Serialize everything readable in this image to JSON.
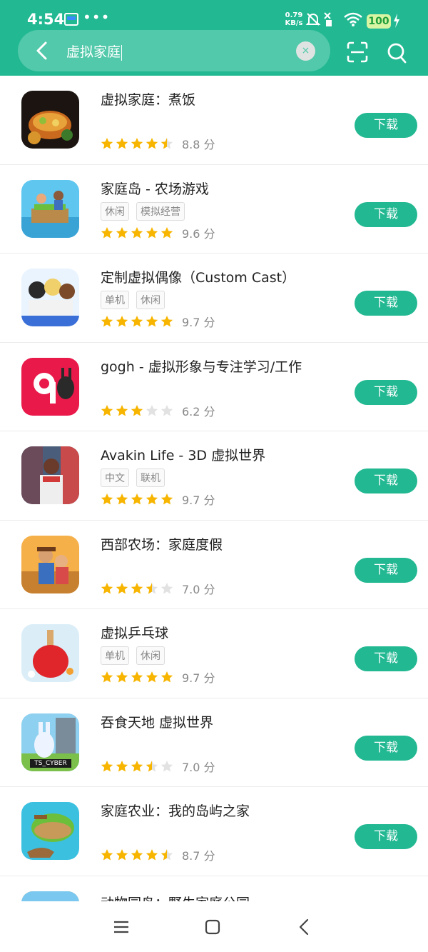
{
  "status_bar": {
    "time": "4:54",
    "net_speed_value": "0.79",
    "net_speed_unit": "KB/s",
    "battery": "100"
  },
  "search": {
    "query": "虚拟家庭",
    "clear_symbol": "×"
  },
  "colors": {
    "accent": "#22b892",
    "star_filled": "#f7b500",
    "star_empty": "#e2e2e2"
  },
  "apps": [
    {
      "name": "虚拟家庭：煮饭",
      "tags": [],
      "rating": 4.5,
      "score": "8.8 分",
      "button": "下载"
    },
    {
      "name": "家庭岛 - 农场游戏",
      "tags": [
        "休闲",
        "模拟经营"
      ],
      "rating": 5,
      "score": "9.6 分",
      "button": "下载"
    },
    {
      "name": "定制虚拟偶像（Custom Cast）",
      "tags": [
        "单机",
        "休闲"
      ],
      "rating": 5,
      "score": "9.7 分",
      "button": "下载"
    },
    {
      "name": "gogh - 虚拟形象与专注学习/工作",
      "tags": [],
      "rating": 3,
      "score": "6.2 分",
      "button": "下载"
    },
    {
      "name": "Avakin Life - 3D 虚拟世界",
      "tags": [
        "中文",
        "联机"
      ],
      "rating": 5,
      "score": "9.7 分",
      "button": "下载"
    },
    {
      "name": "西部农场：家庭度假",
      "tags": [],
      "rating": 3.5,
      "score": "7.0 分",
      "button": "下载"
    },
    {
      "name": "虚拟乒乓球",
      "tags": [
        "单机",
        "休闲"
      ],
      "rating": 5,
      "score": "9.7 分",
      "button": "下载"
    },
    {
      "name": "吞食天地 虚拟世界",
      "tags": [],
      "rating": 3.5,
      "score": "7.0 分",
      "button": "下载"
    },
    {
      "name": "家庭农业：我的岛屿之家",
      "tags": [],
      "rating": 4.5,
      "score": "8.7 分",
      "button": "下载"
    }
  ],
  "partial_app": {
    "name": "动物园岛：野生家庭公园"
  },
  "icon_badge_texts": {
    "tiny_tower": "TS_CYBER"
  }
}
